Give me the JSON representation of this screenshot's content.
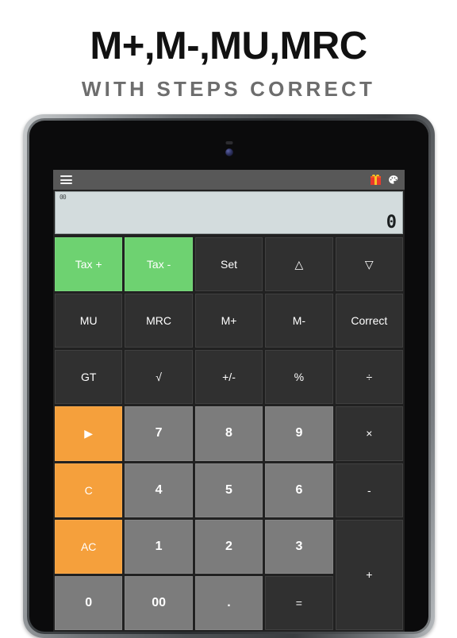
{
  "promo": {
    "title": "M+,M-,MU,MRC",
    "subtitle": "WITH STEPS CORRECT"
  },
  "device": {
    "type": "tablet",
    "sensor": "proximity-sensor",
    "camera": "front-camera"
  },
  "app": {
    "appbar": {
      "menu_label": "menu-icon",
      "actions": [
        {
          "name": "gift-icon",
          "label": ""
        },
        {
          "name": "palette-icon",
          "label": ""
        }
      ]
    },
    "display": {
      "memory_indicator": "00",
      "value": "0"
    },
    "keypad": {
      "rows": [
        [
          {
            "label": "Tax +",
            "style": "green"
          },
          {
            "label": "Tax -",
            "style": "green"
          },
          {
            "label": "Set",
            "style": "fn"
          },
          {
            "label": "△",
            "style": "fn"
          },
          {
            "label": "▽",
            "style": "fn"
          }
        ],
        [
          {
            "label": "MU",
            "style": "fn"
          },
          {
            "label": "MRC",
            "style": "fn"
          },
          {
            "label": "M+",
            "style": "fn"
          },
          {
            "label": "M-",
            "style": "fn"
          },
          {
            "label": "Correct",
            "style": "fn"
          }
        ],
        [
          {
            "label": "GT",
            "style": "fn"
          },
          {
            "label": "√",
            "style": "fn"
          },
          {
            "label": "+/-",
            "style": "fn"
          },
          {
            "label": "%",
            "style": "fn"
          },
          {
            "label": "÷",
            "style": "op"
          }
        ],
        [
          {
            "label": "▶",
            "style": "orange"
          },
          {
            "label": "7",
            "style": "num"
          },
          {
            "label": "8",
            "style": "num"
          },
          {
            "label": "9",
            "style": "num"
          },
          {
            "label": "×",
            "style": "op"
          }
        ],
        [
          {
            "label": "C",
            "style": "orange"
          },
          {
            "label": "4",
            "style": "num"
          },
          {
            "label": "5",
            "style": "num"
          },
          {
            "label": "6",
            "style": "num"
          },
          {
            "label": "-",
            "style": "op"
          }
        ],
        [
          {
            "label": "AC",
            "style": "orange"
          },
          {
            "label": "1",
            "style": "num"
          },
          {
            "label": "2",
            "style": "num"
          },
          {
            "label": "3",
            "style": "num"
          },
          {
            "label": "+",
            "style": "op tall"
          }
        ],
        [
          {
            "label": "0",
            "style": "num"
          },
          {
            "label": "00",
            "style": "num"
          },
          {
            "label": ".",
            "style": "num"
          },
          {
            "label": "=",
            "style": "op"
          }
        ]
      ]
    }
  },
  "colors": {
    "accent_green": "#6ed271",
    "accent_orange": "#f5a03c",
    "key_number": "#7c7c7c",
    "key_function": "#303030",
    "display_bg": "#d3dcdd",
    "appbar_bg": "#585858",
    "page_bg": "#ffffff"
  }
}
